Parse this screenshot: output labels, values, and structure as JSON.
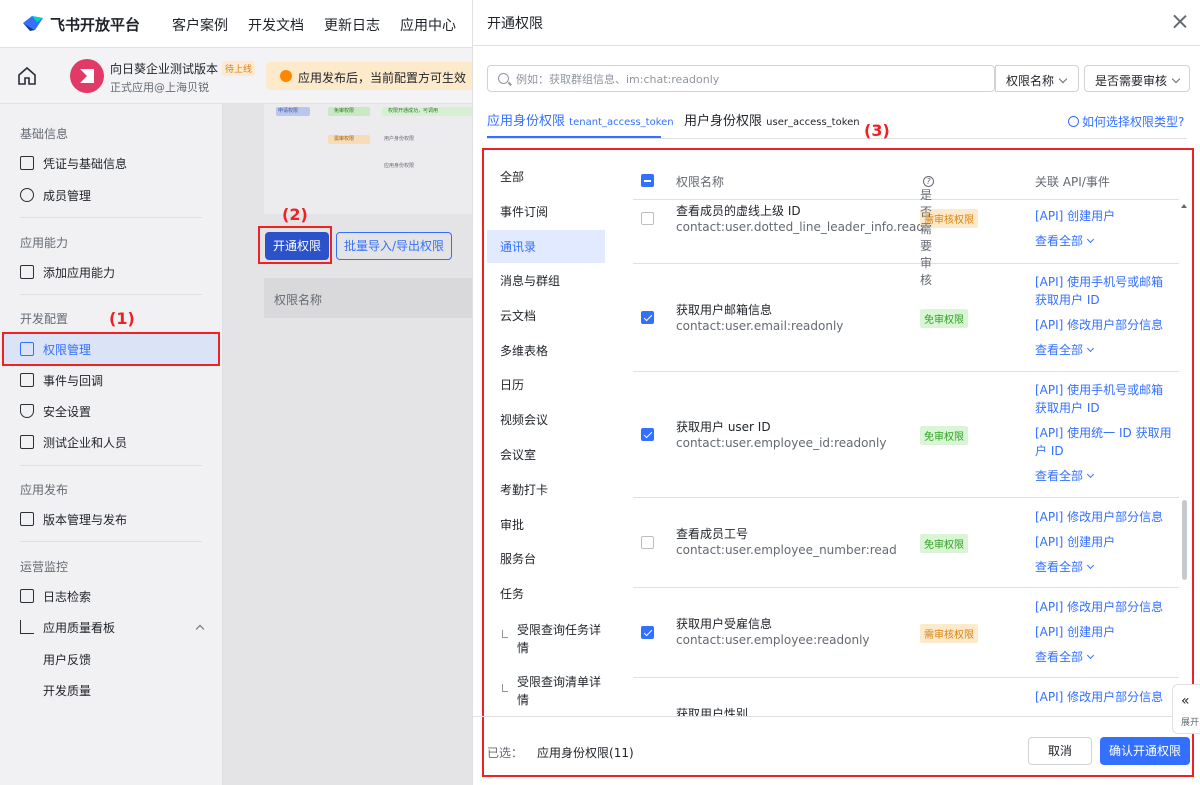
{
  "topnav": {
    "brand": "飞书开放平台",
    "links": [
      "客户案例",
      "开发文档",
      "更新日志",
      "应用中心"
    ]
  },
  "app": {
    "name": "向日葵企业测试版本",
    "status_tag": "待上线",
    "subtitle": "正式应用@上海贝锐",
    "notice": "应用发布后，当前配置方可生效"
  },
  "sidebar": {
    "sections": [
      {
        "title": "基础信息",
        "items": [
          "凭证与基础信息",
          "成员管理"
        ]
      },
      {
        "title": "应用能力",
        "items": [
          "添加应用能力"
        ]
      },
      {
        "title": "开发配置",
        "items": [
          "权限管理",
          "事件与回调",
          "安全设置",
          "测试企业和人员"
        ]
      },
      {
        "title": "应用发布",
        "items": [
          "版本管理与发布"
        ]
      },
      {
        "title": "运营监控",
        "items": [
          "日志检索",
          "应用质量看板",
          "用户反馈",
          "开发质量"
        ]
      }
    ]
  },
  "main": {
    "open_perm_button": "开通权限",
    "batch_button": "批量导入/导出权限",
    "table_header": "权限名称",
    "diagram_labels": [
      "申请权限",
      "免审权限",
      "权限开通成功，可调用",
      "需审权限",
      "用户身份权限",
      "应用身份权限"
    ]
  },
  "annotations": {
    "step1": "1",
    "step2": "2",
    "step3": "3"
  },
  "modal": {
    "title": "开通权限",
    "search_placeholder": "例如：获取群组信息、im:chat:readonly",
    "filter1": "权限名称",
    "filter2": "是否需要审核",
    "tabs": [
      {
        "label": "应用身份权限",
        "sub": "tenant_access_token"
      },
      {
        "label": "用户身份权限",
        "sub": "user_access_token"
      }
    ],
    "help_link": "如何选择权限类型?",
    "categories": [
      "全部",
      "事件订阅",
      "通讯录",
      "消息与群组",
      "云文档",
      "多维表格",
      "日历",
      "视频会议",
      "会议室",
      "考勤打卡",
      "审批",
      "服务台",
      "任务"
    ],
    "subcategories": [
      "受限查询任务详情",
      "受限查询清单详情"
    ],
    "columns": {
      "name": "权限名称",
      "review": "是否需要审核",
      "api": "关联 API/事件"
    },
    "rows": [
      {
        "name": "查看成员的虚线上级 ID",
        "code": "contact:user.dotted_line_leader_info.read",
        "badge": "需审核权限",
        "checked": false,
        "apis": [
          "[API] 创建用户"
        ],
        "more": "查看全部"
      },
      {
        "name": "获取用户邮箱信息",
        "code": "contact:user.email:readonly",
        "badge": "免审权限",
        "checked": true,
        "apis": [
          "[API] 使用手机号或邮箱获取用户 ID",
          "[API] 修改用户部分信息"
        ],
        "more": "查看全部"
      },
      {
        "name": "获取用户 user ID",
        "code": "contact:user.employee_id:readonly",
        "badge": "免审权限",
        "checked": true,
        "apis": [
          "[API] 使用手机号或邮箱获取用户 ID",
          "[API] 使用统一 ID 获取用户 ID"
        ],
        "more": "查看全部"
      },
      {
        "name": "查看成员工号",
        "code": "contact:user.employee_number:read",
        "badge": "免审权限",
        "checked": false,
        "apis": [
          "[API] 修改用户部分信息",
          "[API] 创建用户"
        ],
        "more": "查看全部"
      },
      {
        "name": "获取用户受雇信息",
        "code": "contact:user.employee:readonly",
        "badge": "需审核权限",
        "checked": true,
        "apis": [
          "[API] 修改用户部分信息",
          "[API] 创建用户"
        ],
        "more": "查看全部"
      },
      {
        "name": "获取用户性别",
        "code": "",
        "badge": "",
        "checked": false,
        "apis": [
          "[API] 修改用户部分信息"
        ],
        "more": ""
      }
    ],
    "selected_label": "已选：",
    "selected_value": "应用身份权限(11)",
    "cancel": "取消",
    "confirm": "确认开通权限",
    "expand_label": "展开"
  },
  "colors": {
    "accent": "#3370ff",
    "annotation": "#e22222",
    "free": "#2ea121",
    "review": "#d88212"
  }
}
